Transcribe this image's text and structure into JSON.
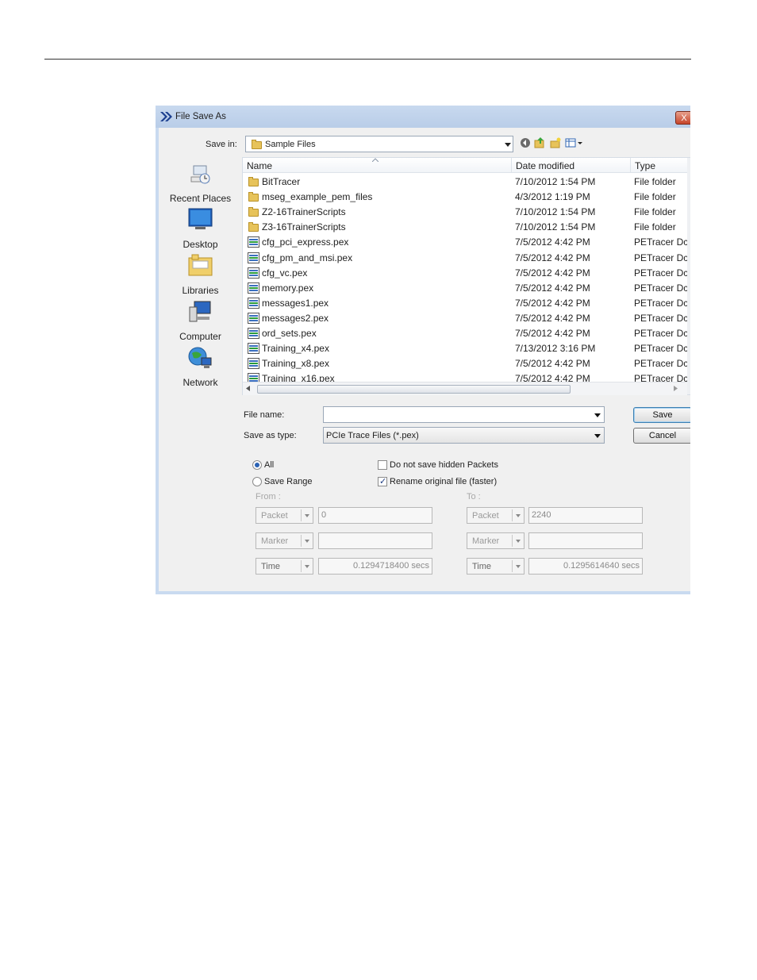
{
  "dialog": {
    "title": "File Save As",
    "close_label": "X",
    "save_in_label": "Save in:",
    "save_in_value": "Sample Files",
    "toolbar_icons": [
      "back-icon",
      "up-folder-icon",
      "new-folder-icon",
      "view-menu-icon"
    ]
  },
  "places": [
    {
      "label": "Recent Places",
      "icon": "recent-places-icon"
    },
    {
      "label": "Desktop",
      "icon": "desktop-icon"
    },
    {
      "label": "Libraries",
      "icon": "libraries-icon"
    },
    {
      "label": "Computer",
      "icon": "computer-icon"
    },
    {
      "label": "Network",
      "icon": "network-icon"
    }
  ],
  "file_list": {
    "columns": [
      "Name",
      "Date modified",
      "Type"
    ],
    "rows": [
      {
        "name": "BitTracer",
        "date": "7/10/2012 1:54 PM",
        "type": "File folder",
        "kind": "folder"
      },
      {
        "name": "mseg_example_pem_files",
        "date": "4/3/2012 1:19 PM",
        "type": "File folder",
        "kind": "folder"
      },
      {
        "name": "Z2-16TrainerScripts",
        "date": "7/10/2012 1:54 PM",
        "type": "File folder",
        "kind": "folder"
      },
      {
        "name": "Z3-16TrainerScripts",
        "date": "7/10/2012 1:54 PM",
        "type": "File folder",
        "kind": "folder"
      },
      {
        "name": "cfg_pci_express.pex",
        "date": "7/5/2012 4:42 PM",
        "type": "PETracer Dc",
        "kind": "pex"
      },
      {
        "name": "cfg_pm_and_msi.pex",
        "date": "7/5/2012 4:42 PM",
        "type": "PETracer Dc",
        "kind": "pex"
      },
      {
        "name": "cfg_vc.pex",
        "date": "7/5/2012 4:42 PM",
        "type": "PETracer Dc",
        "kind": "pex"
      },
      {
        "name": "memory.pex",
        "date": "7/5/2012 4:42 PM",
        "type": "PETracer Dc",
        "kind": "pex"
      },
      {
        "name": "messages1.pex",
        "date": "7/5/2012 4:42 PM",
        "type": "PETracer Dc",
        "kind": "pex"
      },
      {
        "name": "messages2.pex",
        "date": "7/5/2012 4:42 PM",
        "type": "PETracer Dc",
        "kind": "pex"
      },
      {
        "name": "ord_sets.pex",
        "date": "7/5/2012 4:42 PM",
        "type": "PETracer Dc",
        "kind": "pex"
      },
      {
        "name": "Training_x4.pex",
        "date": "7/13/2012 3:16 PM",
        "type": "PETracer Dc",
        "kind": "pex"
      },
      {
        "name": "Training_x8.pex",
        "date": "7/5/2012 4:42 PM",
        "type": "PETracer Dc",
        "kind": "pex"
      },
      {
        "name": "Training_x16.pex",
        "date": "7/5/2012 4:42 PM",
        "type": "PETracer Dc",
        "kind": "pex"
      }
    ]
  },
  "form": {
    "file_name_label": "File name:",
    "file_name_value": "",
    "save_as_type_label": "Save as type:",
    "save_as_type_value": "PCIe Trace Files (*.pex)",
    "save_button": "Save",
    "cancel_button": "Cancel"
  },
  "options": {
    "all_label": "All",
    "all_checked": true,
    "save_range_label": "Save Range",
    "save_range_checked": false,
    "hidden_packets_label": "Do not save hidden Packets",
    "hidden_packets_checked": false,
    "rename_label": "Rename original file (faster)",
    "rename_checked": true
  },
  "range": {
    "from_label": "From :",
    "to_label": "To :",
    "from": {
      "packet_label": "Packet",
      "packet_value": "0",
      "marker_label": "Marker",
      "marker_value": "",
      "time_label": "Time",
      "time_value": "0.1294718400 secs"
    },
    "to": {
      "packet_label": "Packet",
      "packet_value": "2240",
      "marker_label": "Marker",
      "marker_value": "",
      "time_label": "Time",
      "time_value": "0.1295614640 secs"
    }
  }
}
